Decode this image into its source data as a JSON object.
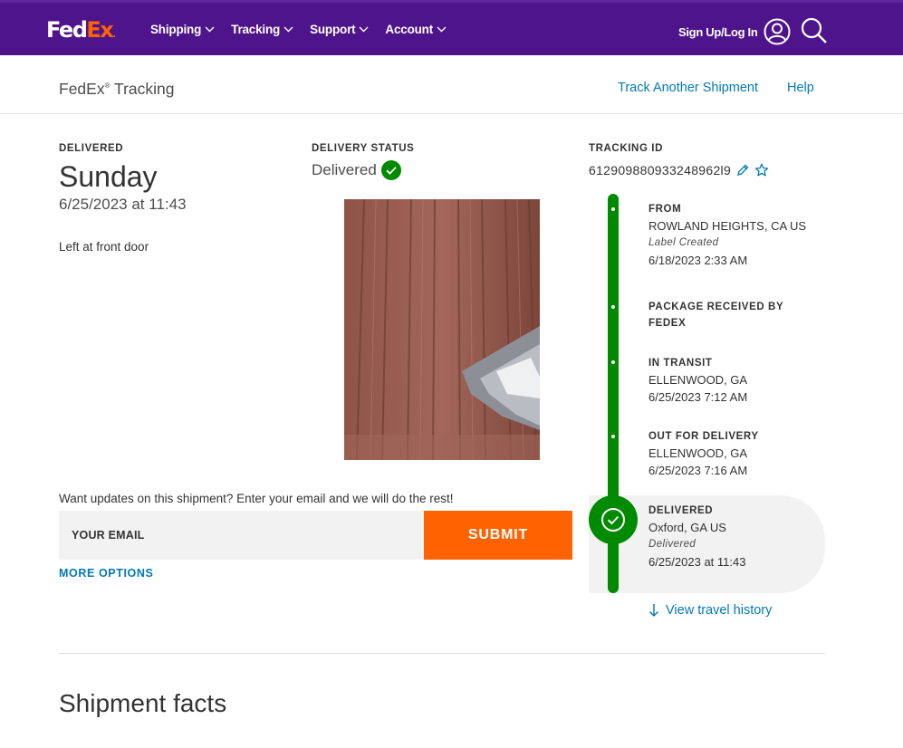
{
  "brand": {
    "logo_fed": "Fed",
    "logo_ex": "Ex",
    "logo_dot": ".",
    "purple": "#4d148c",
    "orange": "#ff6200",
    "green": "#008a00",
    "link_blue": "#007ab7"
  },
  "nav": {
    "items": [
      {
        "label": "Shipping"
      },
      {
        "label": "Tracking"
      },
      {
        "label": "Support"
      },
      {
        "label": "Account"
      }
    ],
    "signin_label": "Sign Up/Log In",
    "icons": {
      "avatar": "user-circle-icon",
      "search": "search-icon",
      "chevron": "chevron-down-icon"
    }
  },
  "subheader": {
    "title": "FedEx",
    "title_reg": "®",
    "title_suffix": " Tracking",
    "track_another": "Track Another Shipment",
    "help": "Help"
  },
  "delivered": {
    "label": "DELIVERED",
    "day": "Sunday",
    "datetime": "6/25/2023 at 11:43",
    "left_at": "Left at front door"
  },
  "status": {
    "label": "DELIVERY STATUS",
    "value": "Delivered"
  },
  "tracking": {
    "label": "TRACKING ID",
    "id": "612909880933248962l9",
    "id_display": "6129098809332489621 9"
  },
  "email": {
    "prompt": "Want updates on this shipment? Enter your email and we will do the rest!",
    "placeholder": "YOUR EMAIL",
    "submit": "SUBMIT",
    "more_options": "MORE OPTIONS"
  },
  "timeline": {
    "events": [
      {
        "title": "FROM",
        "line1": "ROWLAND HEIGHTS, CA US",
        "italic": "Label Created",
        "line2": "6/18/2023 2:33 AM"
      },
      {
        "title_line1": "PACKAGE RECEIVED BY",
        "title_line2": "FEDEX"
      },
      {
        "title": "IN TRANSIT",
        "line1": "ELLENWOOD, GA",
        "line2": "6/25/2023 7:12 AM"
      },
      {
        "title": "OUT FOR DELIVERY",
        "line1": "ELLENWOOD, GA",
        "line2": "6/25/2023 7:16 AM"
      },
      {
        "title": "DELIVERED",
        "line1": "Oxford, GA US",
        "italic": "Delivered",
        "line2": "6/25/2023 at 11:43"
      }
    ],
    "view_history": "View travel history"
  },
  "shipment_facts": {
    "title": "Shipment facts"
  }
}
